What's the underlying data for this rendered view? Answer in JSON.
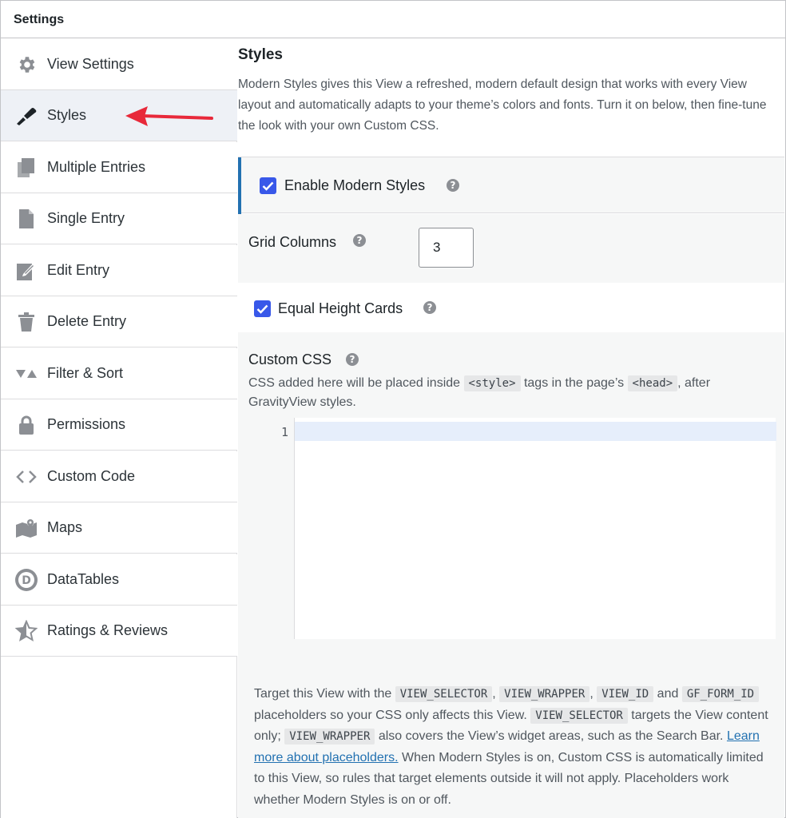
{
  "window": {
    "title": "Settings"
  },
  "sidebar": {
    "items": [
      {
        "label": "View Settings",
        "icon": "gear-icon"
      },
      {
        "label": "Styles",
        "icon": "paintbrush-icon",
        "active": true
      },
      {
        "label": "Multiple Entries",
        "icon": "copy-icon"
      },
      {
        "label": "Single Entry",
        "icon": "document-icon"
      },
      {
        "label": "Edit Entry",
        "icon": "edit-icon"
      },
      {
        "label": "Delete Entry",
        "icon": "trash-icon"
      },
      {
        "label": "Filter & Sort",
        "icon": "filter-icon"
      },
      {
        "label": "Permissions",
        "icon": "lock-icon"
      },
      {
        "label": "Custom Code",
        "icon": "code-icon"
      },
      {
        "label": "Maps",
        "icon": "map-icon"
      },
      {
        "label": "DataTables",
        "icon": "datatables-icon"
      },
      {
        "label": "Ratings & Reviews",
        "icon": "star-icon"
      }
    ]
  },
  "annotation": {
    "arrow_color": "#e8293a"
  },
  "main": {
    "title": "Styles",
    "intro": "Modern Styles gives this View a refreshed, modern default design that works with every View layout and automatically adapts to your theme’s colors and fonts. Turn it on below, then fine-tune the look with your own Custom CSS.",
    "enable_modern_styles": {
      "label": "Enable Modern Styles",
      "checked": true
    },
    "grid_columns": {
      "label": "Grid Columns",
      "value": "3"
    },
    "equal_height_cards": {
      "label": "Equal Height Cards",
      "checked": true
    },
    "custom_css": {
      "label": "Custom CSS",
      "desc_before": "CSS added here will be placed inside ",
      "code_style": "<style>",
      "desc_middle": " tags in the page’s ",
      "code_head": "<head>",
      "desc_after": ", after GravityView styles.",
      "line_number": "1"
    },
    "footer": {
      "t1": "Target this View with the ",
      "c1": "VIEW_SELECTOR",
      "t2": ", ",
      "c2": "VIEW_WRAPPER",
      "t3": ", ",
      "c3": "VIEW_ID",
      "t4": " and ",
      "c4": "GF_FORM_ID",
      "t5": " placeholders so your CSS only affects this View. ",
      "c5": "VIEW_SELECTOR",
      "t6": " targets the View content only; ",
      "c6": "VIEW_WRAPPER",
      "t7": " also covers the View’s widget areas, such as the Search Bar. ",
      "link": "Learn more about placeholders.",
      "t8": "  When Modern Styles is on, Custom CSS is automatically limited to this View, so rules that target elements outside it will not apply. Placeholders work whether Modern Styles is on or off."
    }
  },
  "colors": {
    "accent": "#2271b1",
    "checkbox": "#3858e9",
    "active_bg": "#eef1f6"
  }
}
